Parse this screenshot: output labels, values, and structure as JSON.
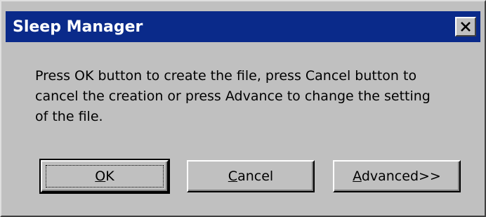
{
  "window": {
    "title": "Sleep Manager",
    "close_icon": "close-icon"
  },
  "message": {
    "line1": "Press OK button to create the file, press Cancel button to",
    "line2": "cancel the creation or press Advance to change the setting",
    "line3": "of the file."
  },
  "buttons": {
    "ok": {
      "mnemonic": "O",
      "rest": "K"
    },
    "cancel": {
      "mnemonic": "C",
      "rest": "ancel"
    },
    "advanced": {
      "mnemonic": "A",
      "rest": "dvanced>>"
    }
  },
  "colors": {
    "titlebar": "#0a2a8a",
    "face": "#c0c0c0"
  }
}
